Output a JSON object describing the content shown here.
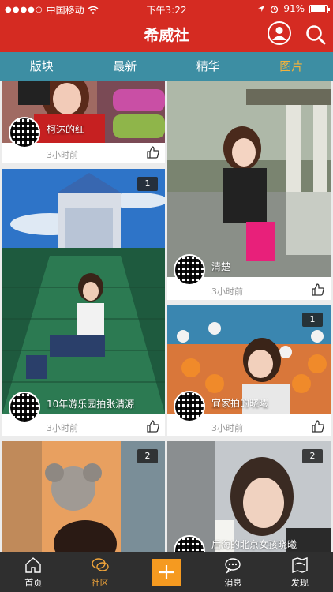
{
  "status": {
    "carrier": "中国移动",
    "time": "下午3:22",
    "battery": "91%",
    "battery_level": 0.91
  },
  "header": {
    "title": "希威社"
  },
  "tabs": [
    {
      "label": "版块",
      "active": false
    },
    {
      "label": "最新",
      "active": false
    },
    {
      "label": "精华",
      "active": false
    },
    {
      "label": "图片",
      "active": true
    }
  ],
  "posts": [
    {
      "title": "柯达的红",
      "time": "3小时前",
      "badge": ""
    },
    {
      "title": "清楚",
      "time": "3小时前",
      "badge": ""
    },
    {
      "title": "10年游乐园拍张清源",
      "time": "3小时前",
      "badge": "1"
    },
    {
      "title": "宜家拍的晓曦",
      "time": "3小时前",
      "badge": "1"
    },
    {
      "title": "",
      "time": "",
      "badge": "2"
    },
    {
      "title": "后海的北京女孩晓曦",
      "time": "",
      "badge": "2"
    }
  ],
  "bottom_nav": [
    {
      "label": "首页",
      "icon": "home-icon",
      "active": false
    },
    {
      "label": "社区",
      "icon": "chat-bubble-icon",
      "active": true
    },
    {
      "label": "",
      "icon": "plus-icon",
      "active": false
    },
    {
      "label": "消息",
      "icon": "message-icon",
      "active": false
    },
    {
      "label": "发现",
      "icon": "map-icon",
      "active": false
    }
  ],
  "colors": {
    "header_red": "#d52b22",
    "tab_teal": "#3d8ea3",
    "active_tab": "#f3b23c",
    "bottom_bar": "#2f2f2f",
    "accent_orange": "#f59a20"
  }
}
